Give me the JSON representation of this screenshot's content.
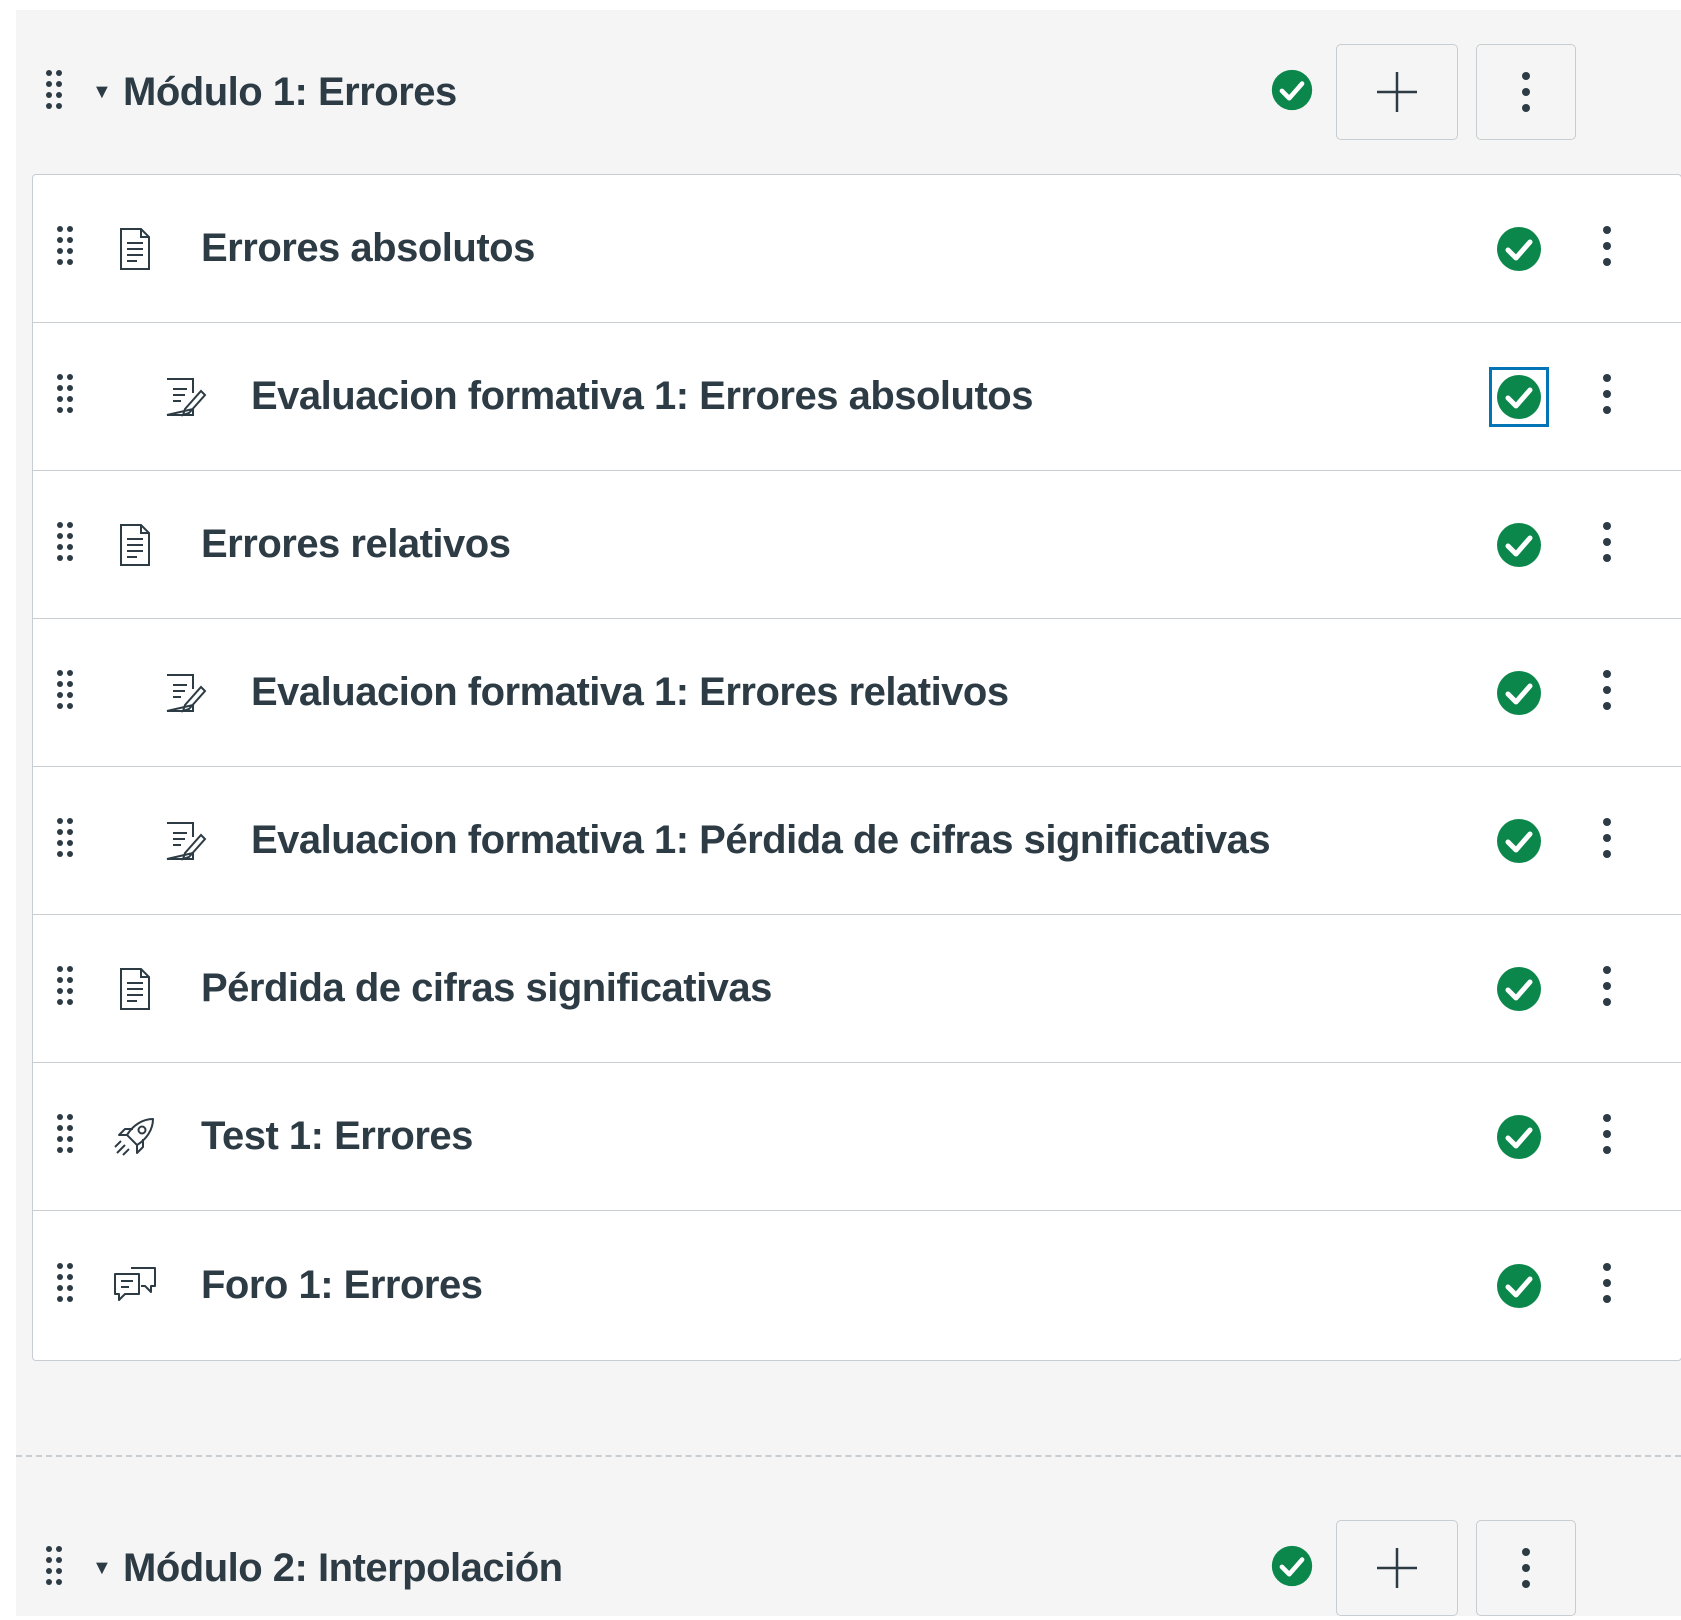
{
  "colors": {
    "published_green": "#0b874b",
    "text": "#2d3b45",
    "focus_blue": "#0374b5",
    "border": "#c7cdd1"
  },
  "modules": [
    {
      "title": "Módulo 1: Errores",
      "published": true,
      "collapse_icon": "triangle-down-icon",
      "add_icon": "plus-icon",
      "more_icon": "kebab-icon",
      "items": [
        {
          "title": "Errores absolutos",
          "type": "page",
          "icon": "document-icon",
          "indent": 0,
          "published": true
        },
        {
          "title": "Evaluacion formativa 1: Errores absolutos",
          "type": "assignment",
          "icon": "assignment-icon",
          "indent": 1,
          "published": true,
          "focused": true
        },
        {
          "title": "Errores relativos",
          "type": "page",
          "icon": "document-icon",
          "indent": 0,
          "published": true
        },
        {
          "title": "Evaluacion formativa 1: Errores relativos",
          "type": "assignment",
          "icon": "assignment-icon",
          "indent": 1,
          "published": true
        },
        {
          "title": "Evaluacion formativa 1: Pérdida de cifras significativas",
          "type": "assignment",
          "icon": "assignment-icon",
          "indent": 1,
          "published": true
        },
        {
          "title": "Pérdida de cifras significativas",
          "type": "page",
          "icon": "document-icon",
          "indent": 0,
          "published": true
        },
        {
          "title": "Test 1: Errores",
          "type": "quiz",
          "icon": "rocket-icon",
          "indent": 0,
          "published": true
        },
        {
          "title": "Foro 1: Errores",
          "type": "discussion",
          "icon": "discussion-icon",
          "indent": 0,
          "published": true
        }
      ]
    },
    {
      "title": "Módulo 2: Interpolación",
      "published": true,
      "collapse_icon": "triangle-down-icon",
      "add_icon": "plus-icon",
      "more_icon": "kebab-icon"
    }
  ]
}
